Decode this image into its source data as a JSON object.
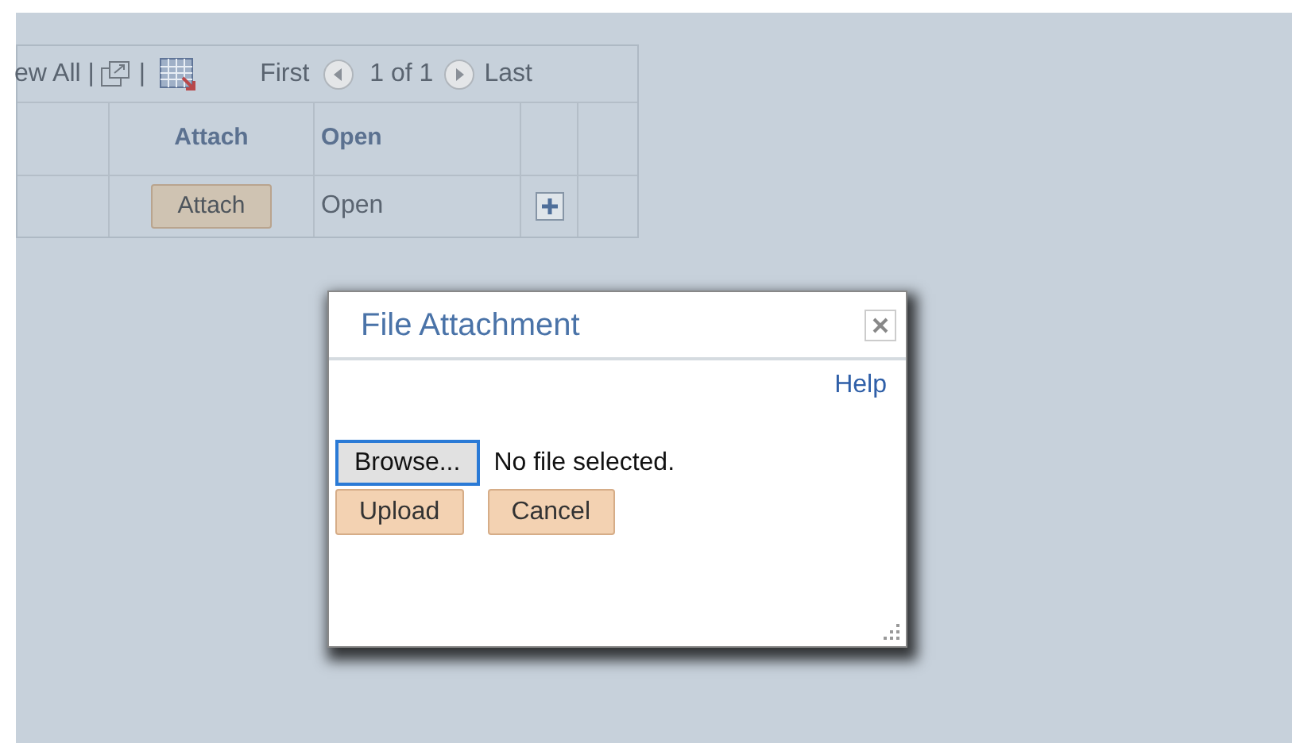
{
  "grid": {
    "toolbar": {
      "view_all": "ew All |",
      "separator": "|",
      "first": "First",
      "page": "1 of 1",
      "last": "Last"
    },
    "columns": [
      "Attach",
      "Open"
    ],
    "rows": [
      {
        "attach": "Attach",
        "open": "Open"
      }
    ]
  },
  "dialog": {
    "title": "File Attachment",
    "help": "Help",
    "browse": "Browse...",
    "file_status": "No file selected.",
    "buttons": [
      "Upload",
      "Cancel"
    ]
  }
}
